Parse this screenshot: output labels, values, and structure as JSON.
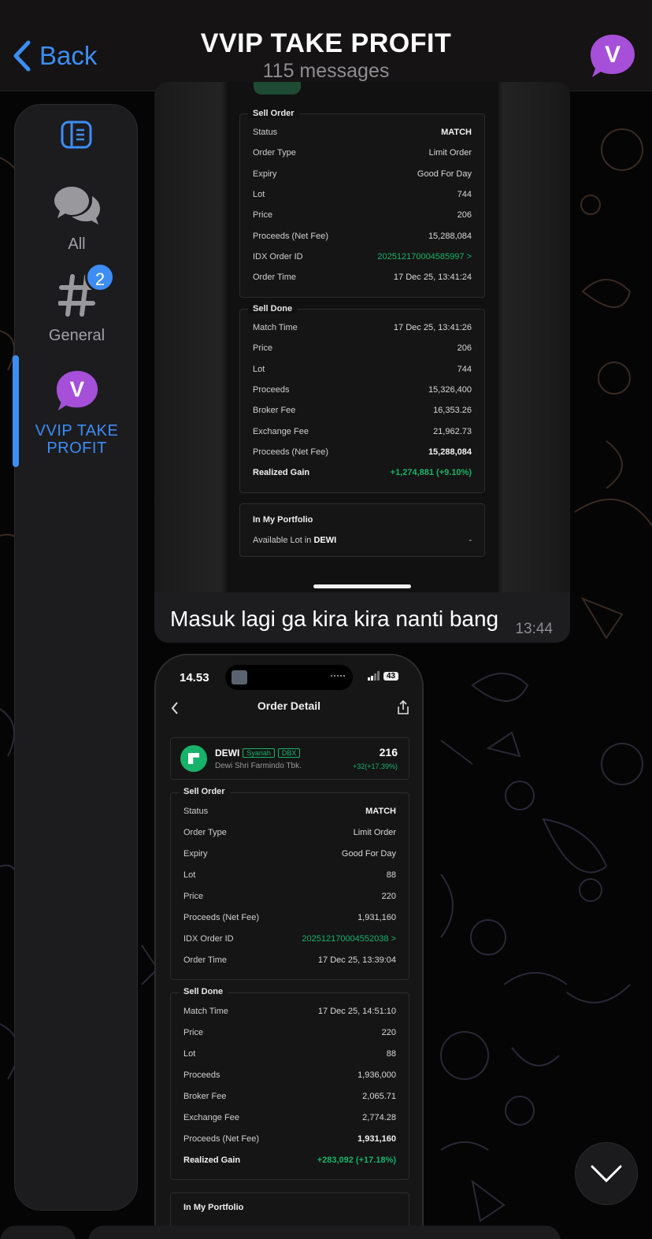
{
  "header": {
    "back_label": "Back",
    "title": "VVIP TAKE PROFIT",
    "subtitle": "115 messages",
    "avatar_letter": "V"
  },
  "sidebar": {
    "items": [
      {
        "label": "All"
      },
      {
        "label": "General",
        "badge": "2"
      },
      {
        "label_line1": "VVIP TAKE",
        "label_line2": "PROFIT",
        "avatar_letter": "V"
      }
    ]
  },
  "message1": {
    "caption": "Masuk lagi ga kira kira nanti bang",
    "time": "13:44",
    "sell_order": {
      "title": "Sell Order",
      "rows": [
        {
          "k": "Status",
          "v": "MATCH"
        },
        {
          "k": "Order Type",
          "v": "Limit Order"
        },
        {
          "k": "Expiry",
          "v": "Good For Day"
        },
        {
          "k": "Lot",
          "v": "744"
        },
        {
          "k": "Price",
          "v": "206"
        },
        {
          "k": "Proceeds (Net Fee)",
          "v": "15,288,084"
        },
        {
          "k": "IDX Order ID",
          "v": "202512170004585997 >"
        },
        {
          "k": "Order Time",
          "v": "17 Dec 25, 13:41:24"
        }
      ]
    },
    "sell_done": {
      "title": "Sell Done",
      "rows": [
        {
          "k": "Match Time",
          "v": "17 Dec 25, 13:41:26"
        },
        {
          "k": "Price",
          "v": "206"
        },
        {
          "k": "Lot",
          "v": "744"
        },
        {
          "k": "Proceeds",
          "v": "15,326,400"
        },
        {
          "k": "Broker Fee",
          "v": "16,353.26"
        },
        {
          "k": "Exchange Fee",
          "v": "21,962.73"
        },
        {
          "k": "Proceeds (Net Fee)",
          "v": "15,288,084"
        },
        {
          "k": "Realized Gain",
          "v": "+1,274,881 (+9.10%)"
        }
      ]
    },
    "portfolio": {
      "title": "In My Portfolio",
      "label": "Available Lot in",
      "ticker": "DEWI",
      "value": "-"
    }
  },
  "message2": {
    "status_time": "14.53",
    "battery": "43",
    "screen_title": "Order Detail",
    "stock": {
      "ticker": "DEWI",
      "tag1": "Syariah",
      "tag2": "DBX",
      "name": "Dewi Shri Farmindo Tbk.",
      "price": "216",
      "change": "+32(+17.39%)"
    },
    "sell_order": {
      "title": "Sell Order",
      "rows": [
        {
          "k": "Status",
          "v": "MATCH"
        },
        {
          "k": "Order Type",
          "v": "Limit Order"
        },
        {
          "k": "Expiry",
          "v": "Good For Day"
        },
        {
          "k": "Lot",
          "v": "88"
        },
        {
          "k": "Price",
          "v": "220"
        },
        {
          "k": "Proceeds (Net Fee)",
          "v": "1,931,160"
        },
        {
          "k": "IDX Order ID",
          "v": "202512170004552038 >"
        },
        {
          "k": "Order Time",
          "v": "17 Dec 25, 13:39:04"
        }
      ]
    },
    "sell_done": {
      "title": "Sell Done",
      "rows": [
        {
          "k": "Match Time",
          "v": "17 Dec 25, 14:51:10"
        },
        {
          "k": "Price",
          "v": "220"
        },
        {
          "k": "Lot",
          "v": "88"
        },
        {
          "k": "Proceeds",
          "v": "1,936,000"
        },
        {
          "k": "Broker Fee",
          "v": "2,065.71"
        },
        {
          "k": "Exchange Fee",
          "v": "2,774.28"
        },
        {
          "k": "Proceeds (Net Fee)",
          "v": "1,931,160"
        },
        {
          "k": "Realized Gain",
          "v": "+283,092 (+17.18%)"
        }
      ]
    },
    "portfolio_title": "In My Portfolio"
  },
  "colors": {
    "accent": "#3d8df5",
    "gain": "#17b36b",
    "avatar": "#a64fd8"
  },
  "icons": [
    "chevron-left-icon",
    "sidebar-toggle-icon",
    "chat-bubbles-icon",
    "hash-icon",
    "chevron-down-icon",
    "share-icon",
    "signal-icon"
  ]
}
